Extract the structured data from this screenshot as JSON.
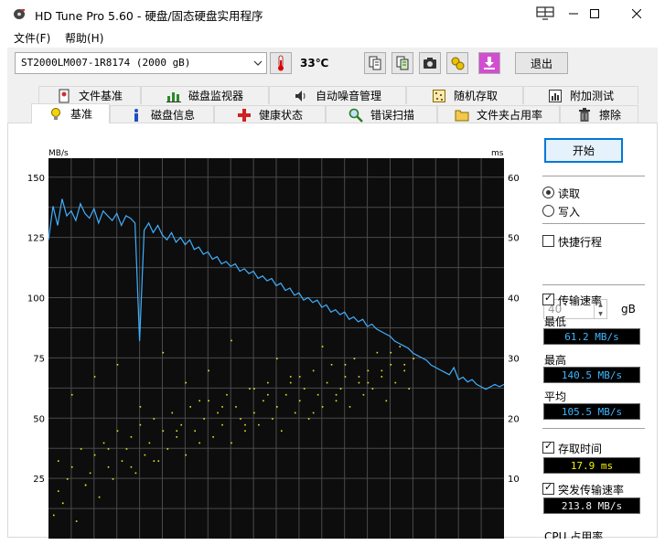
{
  "window": {
    "title": "HD Tune Pro 5.60 - 硬盘/固态硬盘实用程序"
  },
  "menu": {
    "file": "文件(F)",
    "help": "帮助(H)"
  },
  "toolbar": {
    "drive": "ST2000LM007-1R8174 (2000 gB)",
    "temperature": "33℃",
    "exit_label": "退出"
  },
  "tabs_row1": [
    "文件基准",
    "磁盘监视器",
    "自动噪音管理",
    "随机存取",
    "附加测试"
  ],
  "tabs_row2": [
    "基准",
    "磁盘信息",
    "健康状态",
    "错误扫描",
    "文件夹占用率",
    "擦除"
  ],
  "chart_data": {
    "type": "line",
    "units": {
      "left": "MB/s",
      "right": "ms"
    },
    "left_axis": {
      "ticks": [
        150,
        125,
        100,
        75,
        50,
        25
      ],
      "range": [
        0,
        150
      ]
    },
    "right_axis": {
      "ticks": [
        60,
        50,
        40,
        30,
        20,
        10
      ],
      "range": [
        0,
        60
      ]
    },
    "grid": true,
    "series": [
      {
        "x": [
          0,
          1,
          2,
          3,
          4,
          5,
          6,
          7,
          8,
          9,
          10,
          11,
          12,
          13,
          14,
          15,
          16,
          17,
          18,
          19,
          20,
          21,
          22,
          23,
          24,
          25,
          26,
          27,
          28,
          29,
          30,
          31,
          32,
          33,
          34,
          35,
          36,
          37,
          38,
          39,
          40,
          41,
          42,
          43,
          44,
          45,
          46,
          47,
          48,
          49,
          50,
          51,
          52,
          53,
          54,
          55,
          56,
          57,
          58,
          59,
          60,
          61,
          62,
          63,
          64,
          65,
          66,
          67,
          68,
          69,
          70,
          71,
          72,
          73,
          74,
          75,
          76,
          77,
          78,
          79,
          80,
          81,
          82,
          83,
          84,
          85,
          86,
          87,
          88,
          89,
          90,
          91,
          92,
          93,
          94,
          95,
          96,
          97,
          98,
          99,
          100
        ],
        "y": [
          124,
          138,
          130,
          141,
          134,
          136,
          132,
          139,
          135,
          133,
          137,
          131,
          136,
          134,
          132,
          135,
          130,
          134,
          133,
          131,
          82,
          128,
          131,
          127,
          130,
          126,
          124,
          127,
          123,
          125,
          122,
          124,
          120,
          121,
          118,
          119,
          116,
          117,
          114,
          115,
          113,
          114,
          111,
          112,
          110,
          111,
          108,
          109,
          107,
          108,
          105,
          106,
          103,
          104,
          101,
          102,
          99,
          100,
          98,
          99,
          96,
          97,
          94,
          95,
          93,
          94,
          91,
          92,
          90,
          91,
          88,
          89,
          87,
          86,
          85,
          84,
          82,
          81,
          80,
          79,
          77,
          76,
          75,
          74,
          72,
          71,
          70,
          69,
          68,
          71,
          66,
          67,
          65,
          66,
          64,
          63,
          62,
          63,
          64,
          63,
          64
        ]
      }
    ],
    "scatter_right_axis": {
      "x": [
        1,
        2,
        2,
        3,
        4,
        5,
        6,
        7,
        8,
        9,
        10,
        11,
        12,
        13,
        14,
        15,
        16,
        17,
        18,
        19,
        20,
        21,
        22,
        23,
        24,
        25,
        26,
        27,
        28,
        29,
        30,
        31,
        32,
        33,
        34,
        35,
        36,
        37,
        38,
        39,
        40,
        41,
        42,
        43,
        44,
        45,
        46,
        47,
        48,
        49,
        50,
        51,
        52,
        53,
        54,
        55,
        56,
        57,
        58,
        59,
        60,
        61,
        62,
        63,
        64,
        65,
        66,
        67,
        68,
        69,
        70,
        71,
        72,
        73,
        74,
        75,
        76,
        77,
        78,
        79,
        80,
        5,
        10,
        15,
        20,
        25,
        30,
        35,
        40,
        45,
        50,
        55,
        60,
        65,
        70,
        75,
        8,
        18,
        28,
        38,
        48,
        58,
        68,
        78,
        3,
        13,
        23,
        33,
        43,
        53,
        63,
        73
      ],
      "y": [
        4,
        8,
        13,
        6,
        10,
        12,
        3,
        15,
        9,
        11,
        14,
        7,
        16,
        12,
        10,
        18,
        13,
        15,
        17,
        11,
        19,
        14,
        16,
        20,
        13,
        18,
        15,
        21,
        17,
        19,
        14,
        22,
        18,
        16,
        20,
        23,
        17,
        21,
        19,
        24,
        16,
        22,
        20,
        18,
        25,
        21,
        19,
        23,
        26,
        20,
        22,
        18,
        24,
        27,
        21,
        23,
        25,
        20,
        28,
        24,
        22,
        26,
        29,
        23,
        25,
        27,
        22,
        30,
        26,
        24,
        28,
        25,
        31,
        27,
        23,
        29,
        26,
        32,
        28,
        25,
        30,
        24,
        27,
        29,
        22,
        31,
        26,
        28,
        33,
        25,
        30,
        27,
        32,
        29,
        26,
        31,
        9,
        12,
        18,
        22,
        24,
        21,
        27,
        29,
        6,
        15,
        13,
        23,
        19,
        26,
        24,
        28
      ]
    }
  },
  "side": {
    "start_label": "开始",
    "read_label": "读取",
    "write_label": "写入",
    "short_stroke_label": "快捷行程",
    "short_stroke_value": "40",
    "unit_gb": "gB",
    "transfer_rate_label": "传输速率",
    "min_label": "最低",
    "min_value": "61.2 MB/s",
    "max_label": "最高",
    "max_value": "140.5 MB/s",
    "avg_label": "平均",
    "avg_value": "105.5 MB/s",
    "access_time_label": "存取时间",
    "access_time_value": "17.9 ms",
    "burst_rate_label": "突发传输速率",
    "burst_rate_value": "213.8 MB/s",
    "cpu_label": "CPU 占用率"
  }
}
